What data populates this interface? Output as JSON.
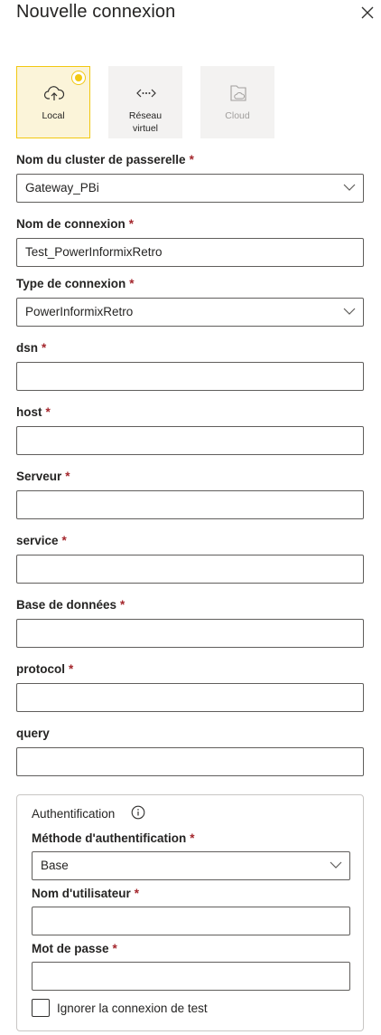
{
  "header": {
    "title": "Nouvelle connexion"
  },
  "location_tiles": [
    {
      "label": "Local",
      "icon": "cloud-upload-icon",
      "state": "selected"
    },
    {
      "label": "Réseau virtuel",
      "icon": "virtual-network-icon",
      "state": "normal"
    },
    {
      "label": "Cloud",
      "icon": "cloud-document-icon",
      "state": "disabled"
    }
  ],
  "form": {
    "gateway_cluster": {
      "label": "Nom du cluster de passerelle",
      "value": "Gateway_PBi"
    },
    "connection_name": {
      "label": "Nom de connexion",
      "value": "Test_PowerInformixRetro"
    },
    "connection_type": {
      "label": "Type de connexion",
      "value": "PowerInformixRetro"
    },
    "dsn": {
      "label": "dsn",
      "value": ""
    },
    "host": {
      "label": "host",
      "value": ""
    },
    "server": {
      "label": "Serveur",
      "value": ""
    },
    "service": {
      "label": "service",
      "value": ""
    },
    "database": {
      "label": "Base de données",
      "value": ""
    },
    "protocol": {
      "label": "protocol",
      "value": ""
    },
    "query": {
      "label": "query",
      "value": ""
    }
  },
  "auth": {
    "title": "Authentification",
    "method": {
      "label": "Méthode d'authentification",
      "value": "Base"
    },
    "username": {
      "label": "Nom d'utilisateur",
      "value": ""
    },
    "password": {
      "label": "Mot de passe",
      "value": ""
    },
    "skip_test": {
      "label": "Ignorer la connexion de test",
      "checked": false
    }
  },
  "required_marker": "*",
  "colors": {
    "accent": "#f2c811",
    "required": "#a4262c",
    "border": "#605e5c"
  }
}
